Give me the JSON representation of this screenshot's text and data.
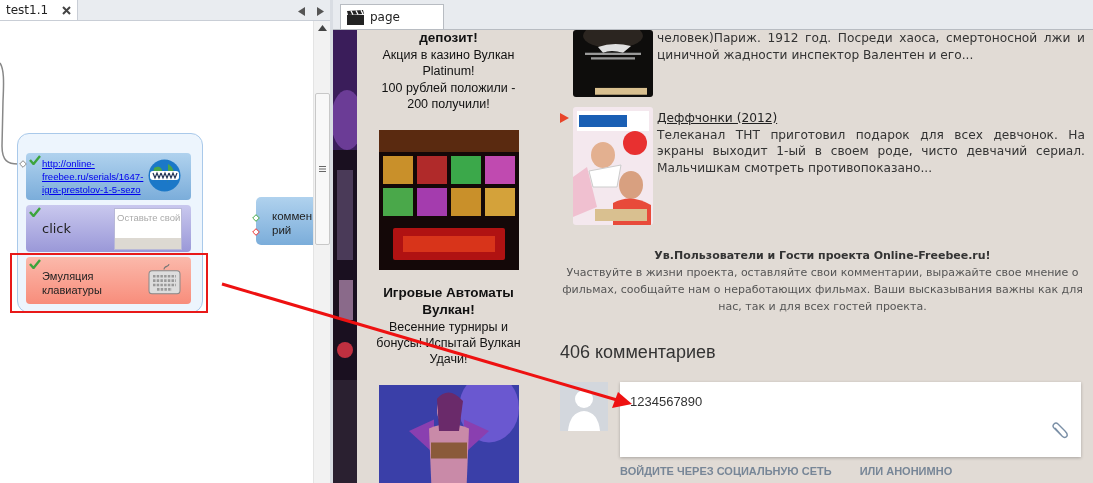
{
  "editor": {
    "tab": {
      "label": "test1.1",
      "selected": true
    },
    "nodes": [
      {
        "kind": "url",
        "text": "http://online-freebee.ru/serials/1647-igra-prestolov-1-5-sezo",
        "done": true,
        "highlighted": false
      },
      {
        "kind": "click",
        "text": "click",
        "preview_placeholder": "Оставьте свой",
        "done": true,
        "highlighted": false
      },
      {
        "kind": "keyboard",
        "text": "Эмуляция клавиатуры",
        "done": true,
        "highlighted": true
      }
    ],
    "side_node": {
      "lines": [
        "коммен",
        "рий"
      ]
    }
  },
  "browser": {
    "tab": {
      "label": "page",
      "selected": true
    },
    "ads": [
      {
        "kind": "heading",
        "text": "депозит!"
      },
      {
        "kind": "line",
        "text": "Акция в казино Вулкан Platinum!"
      },
      {
        "kind": "line",
        "text": "100 рублей положили - 200 получили!"
      },
      {
        "kind": "picture"
      },
      {
        "kind": "heading",
        "text": "Игровые Автоматы Вулкан!"
      },
      {
        "kind": "line",
        "text": "Весенние турниры и бонусы! Испытай Вулкан Удачи!"
      },
      {
        "kind": "picture"
      }
    ],
    "movies": [
      {
        "description": "человек)Париж. 1912 год. Посреди хаоса, смертоносной лжи и циничной жадности инспектор Валентен и его...",
        "marked": false
      },
      {
        "title": "Деффчонки (2012)",
        "description": "Телеканал ТНТ приготовил подарок для всех девчонок. На экраны выходит 1-ый в своем роде, чисто девчачий сериал. Мальчишкам смотреть противопоказано...",
        "marked": true
      }
    ],
    "notice": {
      "title": "Ув.Пользователи и Гости проекта Online-Freebee.ru!",
      "text": "Участвуйте в жизни проекта, оставляйте свои комментарии, выражайте свое мнение о фильмах, сообщайте нам о неработающих фильмах. Ваши высказывания важны как для нас, так и для всех гостей проекта."
    },
    "comments": {
      "count": "406 комментариев",
      "input_value": "1234567890",
      "login_links": [
        "ВОЙДИТЕ ЧЕРЕЗ СОЦИАЛЬНУЮ СЕТЬ",
        "ИЛИ АНОНИМНО"
      ]
    }
  }
}
